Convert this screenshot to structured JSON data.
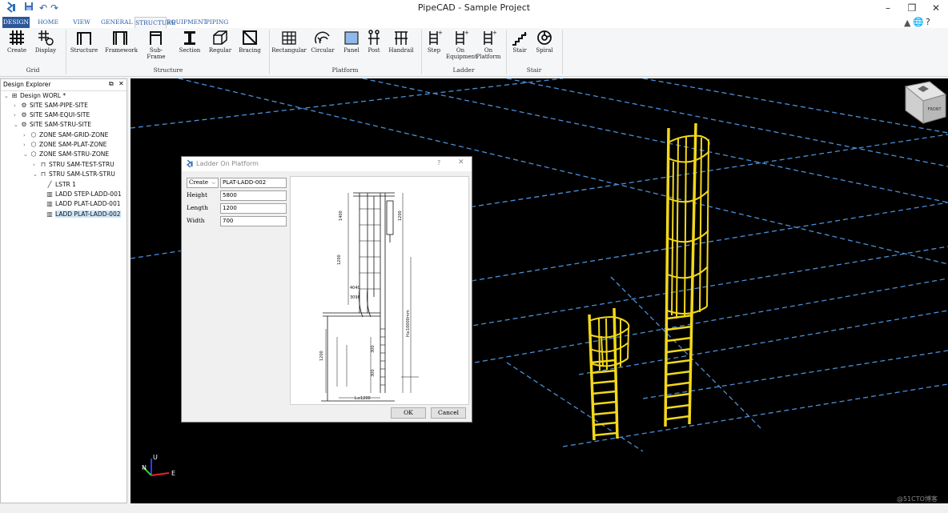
{
  "app": {
    "title": "PipeCAD - Sample Project",
    "tabs": [
      "DESIGN",
      "HOME",
      "VIEW",
      "GENERAL",
      "STRUCTURE",
      "EQUIPMENT",
      "PIPING"
    ],
    "active_tab": "STRUCTURE"
  },
  "ribbon": {
    "groups": {
      "grid": "Grid",
      "structure": "Structure",
      "platform": "Platform",
      "ladder": "Ladder",
      "stair": "Stair"
    },
    "buttons": {
      "create": "Create",
      "display": "Display",
      "structure": "Structure",
      "framework": "Framework",
      "subframe": "Sub-Frame",
      "section": "Section",
      "regular": "Regular",
      "bracing": "Bracing",
      "rectangular": "Rectangular",
      "circular": "Circular",
      "panel": "Panel",
      "post": "Post",
      "handrail": "Handrail",
      "step": "Step",
      "on_equipment_1": "On",
      "on_equipment_2": "Equipment",
      "on_platform_1": "On",
      "on_platform_2": "Platform",
      "stair": "Stair",
      "spiral": "Spiral"
    }
  },
  "explorer": {
    "title": "Design Explorer",
    "nodes": [
      "Design WORL *",
      "SITE SAM-PIPE-SITE",
      "SITE SAM-EQUI-SITE",
      "SITE SAM-STRU-SITE",
      "ZONE SAM-GRID-ZONE",
      "ZONE SAM-PLAT-ZONE",
      "ZONE SAM-STRU-ZONE",
      "STRU SAM-TEST-STRU",
      "STRU SAM-LSTR-STRU",
      "LSTR 1",
      "LADD STEP-LADD-001",
      "LADD PLAT-LADD-001",
      "LADD PLAT-LADD-002"
    ]
  },
  "dialog": {
    "title": "Ladder On Platform",
    "help": "?",
    "mode": "Create",
    "name": "PLAT-LADD-002",
    "height_label": "Height",
    "height_value": "5800",
    "length_label": "Length",
    "length_value": "1200",
    "width_label": "Width",
    "width_value": "700",
    "ok": "OK",
    "cancel": "Cancel"
  },
  "drawing": {
    "dims": [
      "1400",
      "1200",
      "1200",
      "4040",
      "3098",
      "300",
      "300",
      "1200",
      "L≤1200",
      "H≤10000mm"
    ]
  },
  "viewcube": {
    "face": "FRONT"
  },
  "axis": {
    "n": "N",
    "u": "U",
    "e": "E"
  },
  "watermark": "@51CTO博客",
  "colors": {
    "ladder": "#f2d81a",
    "grid": "#4a8fd8",
    "tab_design": "#2b579a"
  }
}
